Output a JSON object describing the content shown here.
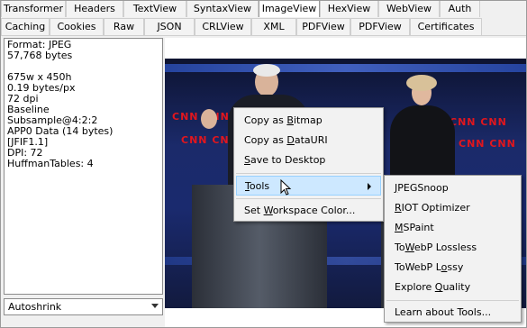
{
  "tabs_row1": [
    {
      "label": "Transformer",
      "active": false
    },
    {
      "label": "Headers",
      "active": false
    },
    {
      "label": "TextView",
      "active": false
    },
    {
      "label": "SyntaxView",
      "active": false
    },
    {
      "label": "ImageView",
      "active": true
    },
    {
      "label": "HexView",
      "active": false
    },
    {
      "label": "WebView",
      "active": false
    },
    {
      "label": "Auth",
      "active": false
    }
  ],
  "tabs_row2": [
    {
      "label": "Caching"
    },
    {
      "label": "Cookies"
    },
    {
      "label": "Raw"
    },
    {
      "label": "JSON"
    },
    {
      "label": "CRLView"
    },
    {
      "label": "XML"
    },
    {
      "label": "PDFView"
    },
    {
      "label": "PDFView"
    },
    {
      "label": "Certificates"
    }
  ],
  "info": {
    "format": "Format: JPEG",
    "size": "57,768 bytes",
    "dimensions": "675w x 450h",
    "bytes_per_px": "0.19 bytes/px",
    "dpi_top": "72 dpi",
    "baseline": "Baseline",
    "subsample": "Subsample@4:2:2",
    "app0": "APP0 Data (14 bytes)",
    "jfif": "[JFIF1.1]",
    "dpi": "DPI: 72",
    "huffman": "HuffmanTables: 4"
  },
  "zoom_select": {
    "value": "Autoshrink"
  },
  "photo_labels": {
    "cnn": "CNN"
  },
  "context_menu": {
    "copy_bitmap": {
      "pre": "Copy as ",
      "key": "B",
      "post": "itmap"
    },
    "copy_datauri": {
      "pre": "Copy as ",
      "key": "D",
      "post": "ataURI"
    },
    "save_desktop": {
      "pre": "",
      "key": "S",
      "post": "ave to Desktop"
    },
    "tools": {
      "pre": "",
      "key": "T",
      "post": "ools"
    },
    "workspace": {
      "pre": "Set ",
      "key": "W",
      "post": "orkspace Color..."
    }
  },
  "tools_submenu": {
    "jpegsnoop": {
      "pre": "",
      "key": "J",
      "post": "PEGSnoop"
    },
    "riot": {
      "pre": "",
      "key": "R",
      "post": "IOT Optimizer"
    },
    "mspaint": {
      "pre": "",
      "key": "M",
      "post": "SPaint"
    },
    "towebp_lossless": {
      "pre": "To",
      "key": "W",
      "post": "ebP Lossless"
    },
    "towebp_lossy": {
      "pre": "ToWebP L",
      "key": "o",
      "post": "ssy"
    },
    "explore_quality": {
      "pre": "Explore ",
      "key": "Q",
      "post": "uality"
    },
    "learn_tools": {
      "pre": "Learn about Tools...",
      "key": "",
      "post": ""
    }
  },
  "colors": {
    "menu_highlight": "#cde8ff",
    "menu_highlight_border": "#99d1ff",
    "cnn_red": "#e2161d"
  }
}
